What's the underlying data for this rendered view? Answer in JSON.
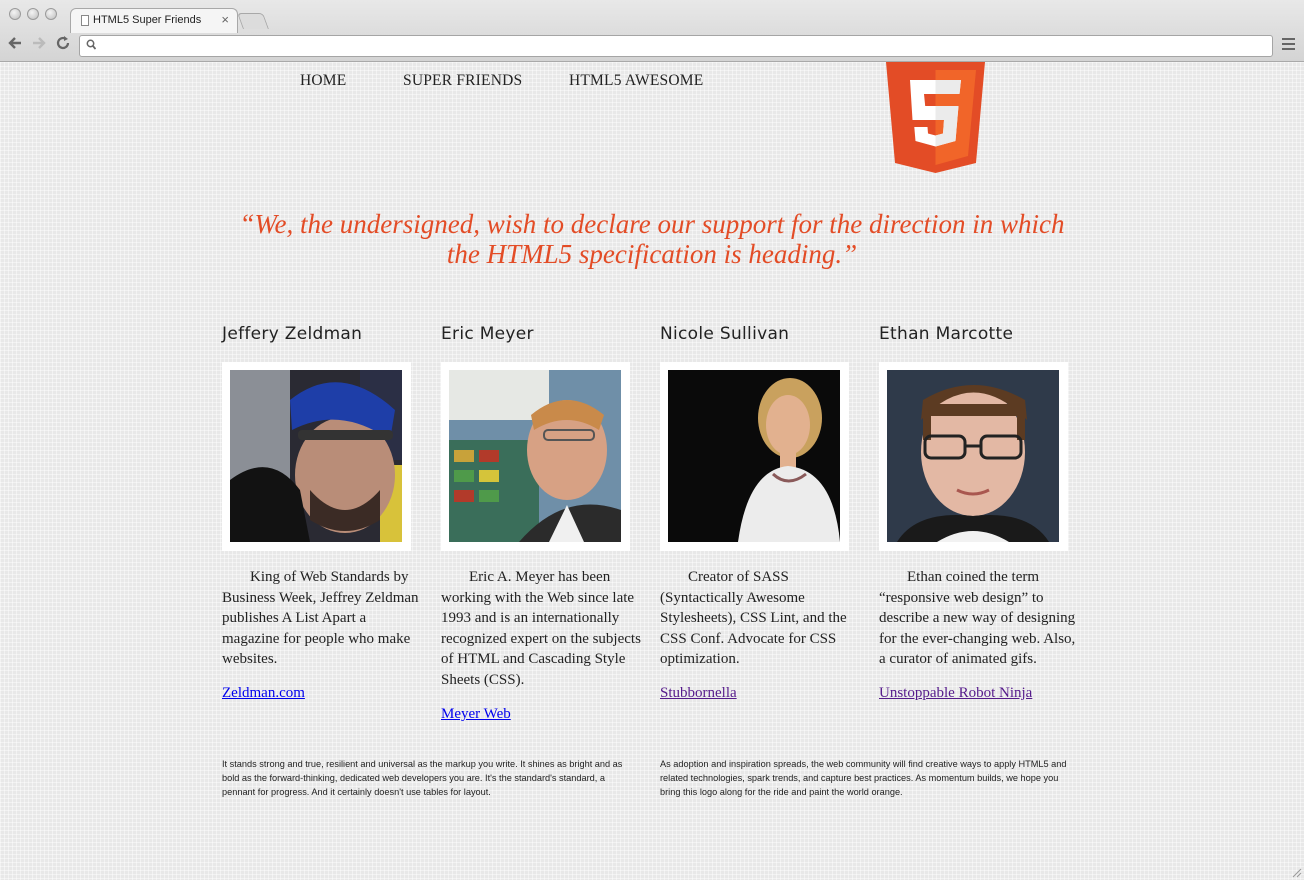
{
  "browser": {
    "tab_title": "HTML5 Super Friends",
    "tab_close": "×",
    "address": "",
    "icons": [
      "back-arrow-icon",
      "forward-arrow-icon",
      "reload-icon",
      "search-icon",
      "menu-icon",
      "document-icon"
    ]
  },
  "nav": {
    "home": "HOME",
    "super_friends": "SUPER FRIENDS",
    "html5_awesome": "HTML5 AWESOME"
  },
  "logo": {
    "text": "5",
    "color": "#e34c26"
  },
  "quote": "“We, the undersigned, wish to declare our support for the direction in which the HTML5 specification is heading.”",
  "friends": [
    {
      "name": "Jeffery Zeldman",
      "bio": "King of Web Standards by Business Week, Jeffrey Zeldman publishes A List Apart a magazine for people who make websites.",
      "link": "Zeldman.com"
    },
    {
      "name": "Eric Meyer",
      "bio": "Eric A. Meyer has been working with the Web since late 1993 and is an internationally recognized expert on the subjects of HTML and Cascading Style Sheets (CSS).",
      "link": "Meyer Web"
    },
    {
      "name": "Nicole Sullivan",
      "bio": "Creator of SASS (Syntactically Awesome Stylesheets), CSS Lint, and the CSS Conf. Advocate for CSS optimization.",
      "link": "Stubbornella"
    },
    {
      "name": "Ethan Marcotte",
      "bio": "Ethan coined the term “responsive web design” to describe a new way of designing for the ever-changing web. Also, a curator of animated gifs.",
      "link": "Unstoppable Robot Ninja"
    }
  ],
  "footer": {
    "left": "It stands strong and true, resilient and universal as the markup you write. It shines as bright and as bold as the forward-thinking, dedicated web developers you are. It's the standard's standard, a pennant for progress. And it certainly doesn't use tables for layout.",
    "right": "As adoption and inspiration spreads, the web community will find creative ways to apply HTML5 and related technologies, spark trends, and capture best practices. As momentum builds, we hope you bring this logo along for the ride and paint the world orange."
  },
  "colors": {
    "accent": "#e34c26",
    "link": "#0000ee",
    "visited": "#551a8b"
  }
}
